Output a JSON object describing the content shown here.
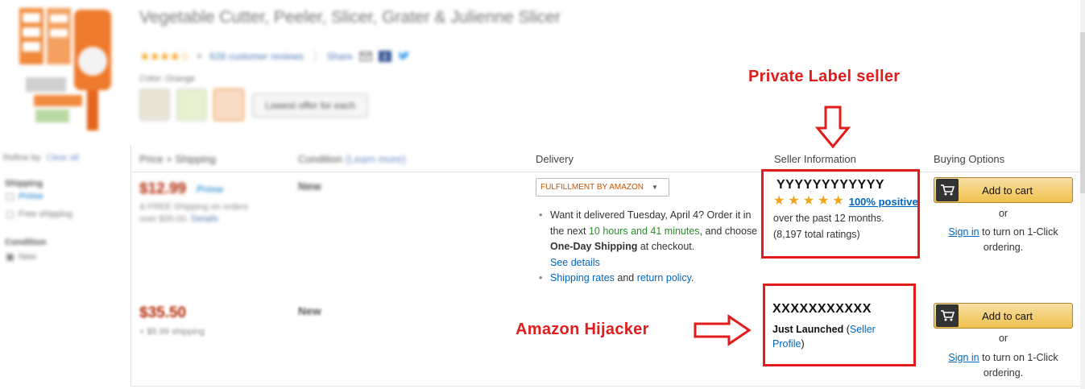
{
  "product": {
    "title": "Vegetable Cutter, Peeler, Slicer, Grater & Julienne Slicer",
    "rating_stars": "★★★★☆",
    "reviews": "628 customer reviews",
    "share_label": "Share",
    "color_label": "Color: Orange",
    "lowest_offer_button": "Lowest offer for each"
  },
  "sidebar": {
    "refine_by": "Refine by",
    "clear_all": "Clear all",
    "shipping_heading": "Shipping",
    "prime_label": "Prime",
    "free_shipping": "Free shipping",
    "condition_heading": "Condition",
    "new_label": "New"
  },
  "columns": {
    "price": "Price + Shipping",
    "condition": "Condition",
    "learn_more": "(Learn more)",
    "delivery": "Delivery",
    "seller": "Seller Information",
    "buying": "Buying Options"
  },
  "offers": [
    {
      "price": "$12.99",
      "prime": "Prime",
      "ship_line1": "& FREE Shipping on orders",
      "ship_line2": "over $35.00.",
      "ship_details": "Details",
      "condition": "New",
      "fulfillment": "FULFILLMENT BY AMAZON",
      "delivery_part1": "Want it delivered Tuesday, April 4? Order it in the next ",
      "delivery_time": "10 hours and 41 minutes",
      "delivery_part2": ", and choose ",
      "delivery_bold": "One-Day Shipping",
      "delivery_part3": " at checkout.",
      "see_details": "See details",
      "shipping_rates": "Shipping rates",
      "and": " and ",
      "return_policy": "return policy",
      "period": ".",
      "seller_name": "YYYYYYYYYYYY",
      "positive": "100% positive",
      "months": "over the past 12 months.",
      "total": "(8,197 total ratings)",
      "cart_label": "Add to cart",
      "or": "or",
      "signin": "Sign in",
      "signin_rest": " to turn on 1-Click ordering."
    },
    {
      "price": "$35.50",
      "ship_line1": "+ $5.99 shipping",
      "condition": "New",
      "seller_name": "XXXXXXXXXXX",
      "launched": "Just Launched",
      "paren_open": " (",
      "profile_link": "Seller Profile",
      "paren_close": ")",
      "cart_label": "Add to cart",
      "or": "or",
      "signin": "Sign in",
      "signin_rest": " to turn on 1-Click ordering."
    }
  ],
  "annotations": {
    "private_label": "Private Label seller",
    "hijacker": "Amazon Hijacker"
  },
  "colors": {
    "annotation_red": "#e21b1b",
    "price_red": "#b12704",
    "link_blue": "#0066c0",
    "button_yellow": "#f0c14b"
  }
}
